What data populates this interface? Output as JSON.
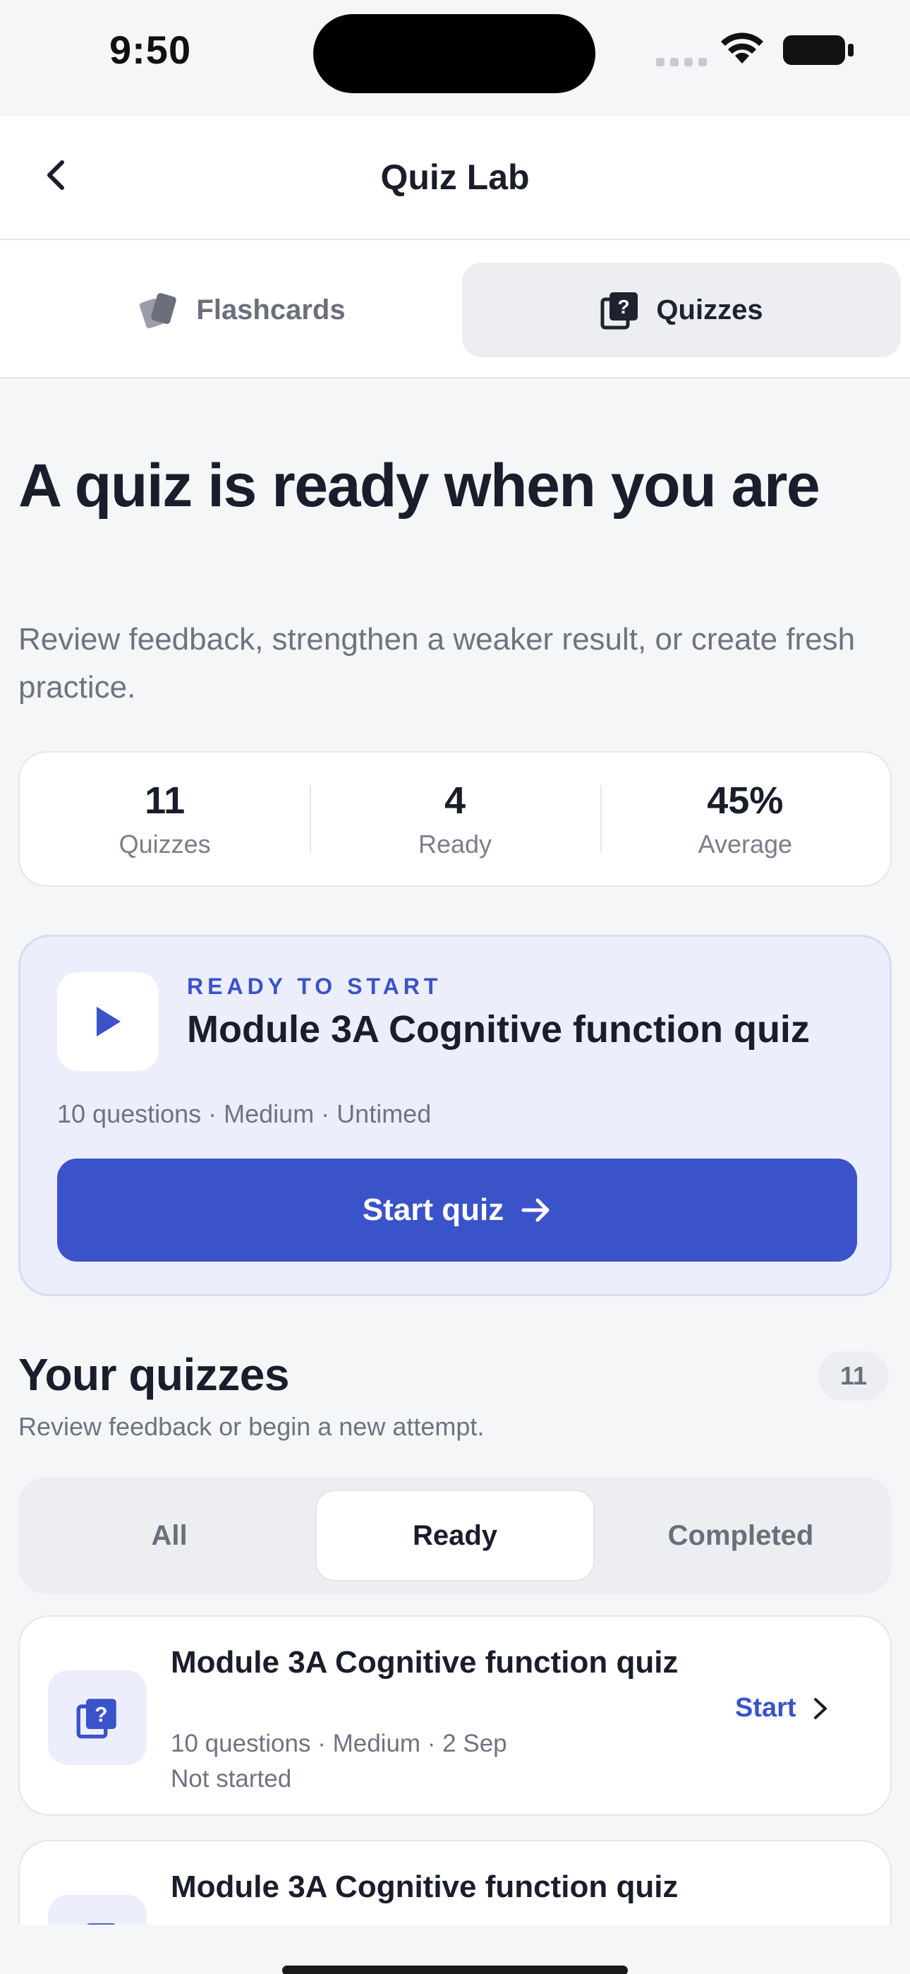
{
  "status_bar": {
    "time": "9:50"
  },
  "header": {
    "title": "Quiz Lab",
    "back_icon": "chevron-left-icon"
  },
  "tabs": [
    {
      "label": "Flashcards",
      "icon": "cards-icon",
      "selected": false
    },
    {
      "label": "Quizzes",
      "icon": "quiz-icon",
      "selected": true
    }
  ],
  "hero": {
    "title": "A quiz is ready when you are",
    "subtitle": "Review feedback, strengthen a weaker result, or create fresh practice."
  },
  "stats": [
    {
      "value": "11",
      "label": "Quizzes"
    },
    {
      "value": "4",
      "label": "Ready"
    },
    {
      "value": "45%",
      "label": "Average"
    }
  ],
  "featured": {
    "eyebrow": "READY TO START",
    "title": "Module 3A Cognitive function quiz",
    "meta": "10 questions · Medium · Untimed",
    "button_label": "Start quiz",
    "button_icon": "arrow-right-icon"
  },
  "quizzes_section": {
    "title": "Your quizzes",
    "count": "11",
    "subtitle": "Review feedback or begin a new attempt.",
    "filters": [
      {
        "label": "All",
        "selected": false
      },
      {
        "label": "Ready",
        "selected": true
      },
      {
        "label": "Completed",
        "selected": false
      }
    ],
    "items": [
      {
        "title": "Module 3A Cognitive function quiz",
        "meta": "10 questions · Medium · 2 Sep",
        "status": "Not started",
        "action": "Start"
      },
      {
        "title": "Module 3A Cognitive function quiz",
        "meta": "",
        "status": "",
        "action": ""
      }
    ]
  },
  "colors": {
    "accent": "#3a53c9",
    "background": "#f5f6f8",
    "feature_bg": "#eceefc"
  }
}
